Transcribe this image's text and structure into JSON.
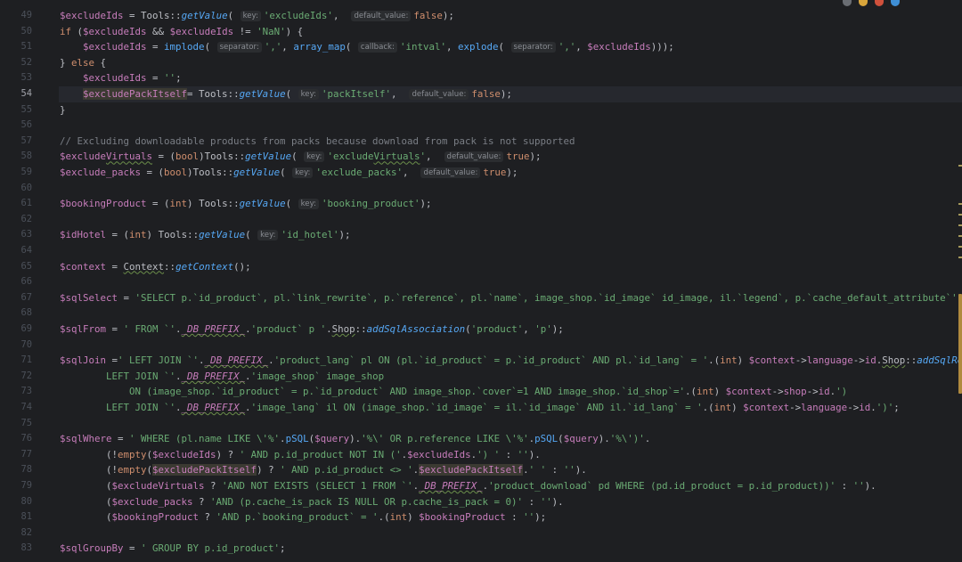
{
  "gutter": {
    "line_numbers": [
      "49",
      "50",
      "51",
      "52",
      "53",
      "54",
      "55",
      "56",
      "57",
      "58",
      "59",
      "60",
      "61",
      "62",
      "63",
      "64",
      "65",
      "66",
      "67",
      "68",
      "69",
      "70",
      "71",
      "72",
      "73",
      "74",
      "75",
      "76",
      "77",
      "78",
      "79",
      "80",
      "81",
      "82",
      "83"
    ],
    "current_line": "54"
  },
  "code_lines": [
    [
      {
        "c": "var",
        "t": "$excludeIds"
      },
      {
        "c": "p",
        "t": " = "
      },
      {
        "c": "cls",
        "t": "Tools"
      },
      {
        "c": "p",
        "t": "::"
      },
      {
        "c": "sfn",
        "t": "getValue"
      },
      {
        "c": "p",
        "t": "( "
      },
      {
        "c": "hint",
        "t": "key:"
      },
      {
        "c": "str",
        "t": "'excludeIds'"
      },
      {
        "c": "p",
        "t": ",  "
      },
      {
        "c": "hint",
        "t": "default_value:"
      },
      {
        "c": "kw",
        "t": "false"
      },
      {
        "c": "p",
        "t": ");"
      }
    ],
    [
      {
        "c": "kw",
        "t": "if"
      },
      {
        "c": "p",
        "t": " ("
      },
      {
        "c": "var",
        "t": "$excludeIds"
      },
      {
        "c": "p",
        "t": " && "
      },
      {
        "c": "var",
        "t": "$excludeIds"
      },
      {
        "c": "p",
        "t": " != "
      },
      {
        "c": "str",
        "t": "'NaN'"
      },
      {
        "c": "p",
        "t": ") {"
      }
    ],
    [
      {
        "c": "p",
        "t": "    "
      },
      {
        "c": "var",
        "t": "$excludeIds"
      },
      {
        "c": "p",
        "t": " = "
      },
      {
        "c": "fn",
        "t": "implode"
      },
      {
        "c": "p",
        "t": "( "
      },
      {
        "c": "hint",
        "t": "separator:"
      },
      {
        "c": "str",
        "t": "','"
      },
      {
        "c": "p",
        "t": ", "
      },
      {
        "c": "fn",
        "t": "array_map"
      },
      {
        "c": "p",
        "t": "( "
      },
      {
        "c": "hint",
        "t": "callback:"
      },
      {
        "c": "str",
        "t": "'intval'"
      },
      {
        "c": "p",
        "t": ", "
      },
      {
        "c": "fn",
        "t": "explode"
      },
      {
        "c": "p",
        "t": "( "
      },
      {
        "c": "hint",
        "t": "separator:"
      },
      {
        "c": "str",
        "t": "','"
      },
      {
        "c": "p",
        "t": ", "
      },
      {
        "c": "var",
        "t": "$excludeIds"
      },
      {
        "c": "p",
        "t": ")));"
      }
    ],
    [
      {
        "c": "p",
        "t": "} "
      },
      {
        "c": "kw",
        "t": "else"
      },
      {
        "c": "p",
        "t": " {"
      }
    ],
    [
      {
        "c": "p",
        "t": "    "
      },
      {
        "c": "var",
        "t": "$excludeIds"
      },
      {
        "c": "p",
        "t": " = "
      },
      {
        "c": "str",
        "t": "''"
      },
      {
        "c": "p",
        "t": ";"
      }
    ],
    [
      {
        "c": "p",
        "t": "    "
      },
      {
        "c": "var hlref",
        "t": "$excludePackItself"
      },
      {
        "c": "p",
        "t": "= "
      },
      {
        "c": "cls",
        "t": "Tools"
      },
      {
        "c": "p",
        "t": "::"
      },
      {
        "c": "sfn",
        "t": "getValue"
      },
      {
        "c": "p",
        "t": "( "
      },
      {
        "c": "hint",
        "t": "key:"
      },
      {
        "c": "str",
        "t": "'packItself'"
      },
      {
        "c": "p",
        "t": ",  "
      },
      {
        "c": "hint",
        "t": "default_value:"
      },
      {
        "c": "kw",
        "t": "false"
      },
      {
        "c": "p",
        "t": ");"
      }
    ],
    [
      {
        "c": "p",
        "t": "}"
      }
    ],
    [],
    [
      {
        "c": "cmt",
        "t": "// Excluding downloadable products from packs because download from pack is not supported"
      }
    ],
    [
      {
        "c": "var",
        "t": "$exclude"
      },
      {
        "c": "var squig",
        "t": "Virtuals"
      },
      {
        "c": "p",
        "t": " = ("
      },
      {
        "c": "kw",
        "t": "bool"
      },
      {
        "c": "p",
        "t": ")"
      },
      {
        "c": "cls",
        "t": "Tools"
      },
      {
        "c": "p",
        "t": "::"
      },
      {
        "c": "sfn",
        "t": "getValue"
      },
      {
        "c": "p",
        "t": "( "
      },
      {
        "c": "hint",
        "t": "key:"
      },
      {
        "c": "str",
        "t": "'exclude"
      },
      {
        "c": "str squig",
        "t": "Virtuals"
      },
      {
        "c": "str",
        "t": "'"
      },
      {
        "c": "p",
        "t": ",  "
      },
      {
        "c": "hint",
        "t": "default_value:"
      },
      {
        "c": "kw",
        "t": "true"
      },
      {
        "c": "p",
        "t": ");"
      }
    ],
    [
      {
        "c": "var",
        "t": "$exclude_packs"
      },
      {
        "c": "p",
        "t": " = ("
      },
      {
        "c": "kw",
        "t": "bool"
      },
      {
        "c": "p",
        "t": ")"
      },
      {
        "c": "cls",
        "t": "Tools"
      },
      {
        "c": "p",
        "t": "::"
      },
      {
        "c": "sfn",
        "t": "getValue"
      },
      {
        "c": "p",
        "t": "( "
      },
      {
        "c": "hint",
        "t": "key:"
      },
      {
        "c": "str",
        "t": "'exclude_packs'"
      },
      {
        "c": "p",
        "t": ",  "
      },
      {
        "c": "hint",
        "t": "default_value:"
      },
      {
        "c": "kw",
        "t": "true"
      },
      {
        "c": "p",
        "t": ");"
      }
    ],
    [],
    [
      {
        "c": "var",
        "t": "$bookingProduct"
      },
      {
        "c": "p",
        "t": " = ("
      },
      {
        "c": "kw",
        "t": "int"
      },
      {
        "c": "p",
        "t": ") "
      },
      {
        "c": "cls",
        "t": "Tools"
      },
      {
        "c": "p",
        "t": "::"
      },
      {
        "c": "sfn",
        "t": "getValue"
      },
      {
        "c": "p",
        "t": "( "
      },
      {
        "c": "hint",
        "t": "key:"
      },
      {
        "c": "str",
        "t": "'booking_product'"
      },
      {
        "c": "p",
        "t": ");"
      }
    ],
    [],
    [
      {
        "c": "var",
        "t": "$idHotel"
      },
      {
        "c": "p",
        "t": " = ("
      },
      {
        "c": "kw",
        "t": "int"
      },
      {
        "c": "p",
        "t": ") "
      },
      {
        "c": "cls",
        "t": "Tools"
      },
      {
        "c": "p",
        "t": "::"
      },
      {
        "c": "sfn",
        "t": "getValue"
      },
      {
        "c": "p",
        "t": "( "
      },
      {
        "c": "hint",
        "t": "key:"
      },
      {
        "c": "str",
        "t": "'id_hotel'"
      },
      {
        "c": "p",
        "t": ");"
      }
    ],
    [],
    [
      {
        "c": "var",
        "t": "$context"
      },
      {
        "c": "p",
        "t": " = "
      },
      {
        "c": "cls squig",
        "t": "Context"
      },
      {
        "c": "p",
        "t": "::"
      },
      {
        "c": "sfn",
        "t": "getContext"
      },
      {
        "c": "p",
        "t": "();"
      }
    ],
    [],
    [
      {
        "c": "var",
        "t": "$sqlSelect"
      },
      {
        "c": "p",
        "t": " = "
      },
      {
        "c": "str",
        "t": "'SELECT p.`id_product`, pl.`link_rewrite`, p.`reference`, pl.`name`, image_shop.`id_image` id_image, il.`legend`, p.`cache_default_attribute`';"
      }
    ],
    [],
    [
      {
        "c": "var",
        "t": "$sqlFrom"
      },
      {
        "c": "p",
        "t": " = "
      },
      {
        "c": "str",
        "t": "' FROM `'"
      },
      {
        "c": "p",
        "t": "."
      },
      {
        "c": "const squig",
        "t": "_DB_PREFIX_"
      },
      {
        "c": "p",
        "t": "."
      },
      {
        "c": "str",
        "t": "'product` p '"
      },
      {
        "c": "p",
        "t": "."
      },
      {
        "c": "cls squig",
        "t": "Shop"
      },
      {
        "c": "p",
        "t": "::"
      },
      {
        "c": "sfn",
        "t": "addSqlAssociation"
      },
      {
        "c": "p",
        "t": "("
      },
      {
        "c": "str",
        "t": "'product'"
      },
      {
        "c": "p",
        "t": ", "
      },
      {
        "c": "str",
        "t": "'p'"
      },
      {
        "c": "p",
        "t": ");"
      }
    ],
    [],
    [
      {
        "c": "var",
        "t": "$sqlJoin"
      },
      {
        "c": "p",
        "t": " ="
      },
      {
        "c": "str",
        "t": "' LEFT JOIN `'"
      },
      {
        "c": "p",
        "t": "."
      },
      {
        "c": "const squig",
        "t": "_DB_PREFIX_"
      },
      {
        "c": "p",
        "t": "."
      },
      {
        "c": "str",
        "t": "'product_lang` pl ON (pl.`id_product` = p.`id_product` AND pl.`id_lang` = '"
      },
      {
        "c": "p",
        "t": ".("
      },
      {
        "c": "kw",
        "t": "int"
      },
      {
        "c": "p",
        "t": ") "
      },
      {
        "c": "var",
        "t": "$context"
      },
      {
        "c": "p",
        "t": "->"
      },
      {
        "c": "var",
        "t": "language"
      },
      {
        "c": "p",
        "t": "->"
      },
      {
        "c": "var",
        "t": "id"
      },
      {
        "c": "p",
        "t": "."
      },
      {
        "c": "cls squig",
        "t": "Shop"
      },
      {
        "c": "p",
        "t": "::"
      },
      {
        "c": "sfn",
        "t": "addSqlRest"
      }
    ],
    [
      {
        "c": "str",
        "t": "        LEFT JOIN `'"
      },
      {
        "c": "p",
        "t": "."
      },
      {
        "c": "const squig",
        "t": "_DB_PREFIX_"
      },
      {
        "c": "p",
        "t": "."
      },
      {
        "c": "str",
        "t": "'image_shop` image_shop"
      }
    ],
    [
      {
        "c": "str",
        "t": "            ON (image_shop.`id_product` = p.`id_product` AND image_shop.`cover`=1 AND image_shop.`id_shop`='"
      },
      {
        "c": "p",
        "t": ".("
      },
      {
        "c": "kw",
        "t": "int"
      },
      {
        "c": "p",
        "t": ") "
      },
      {
        "c": "var",
        "t": "$context"
      },
      {
        "c": "p",
        "t": "->"
      },
      {
        "c": "var",
        "t": "shop"
      },
      {
        "c": "p",
        "t": "->"
      },
      {
        "c": "var",
        "t": "id"
      },
      {
        "c": "p",
        "t": "."
      },
      {
        "c": "str",
        "t": "')"
      }
    ],
    [
      {
        "c": "str",
        "t": "        LEFT JOIN `'"
      },
      {
        "c": "p",
        "t": "."
      },
      {
        "c": "const squig",
        "t": "_DB_PREFIX_"
      },
      {
        "c": "p",
        "t": "."
      },
      {
        "c": "str",
        "t": "'image_lang` il ON (image_shop.`id_image` = il.`id_image` AND il.`id_lang` = '"
      },
      {
        "c": "p",
        "t": ".("
      },
      {
        "c": "kw",
        "t": "int"
      },
      {
        "c": "p",
        "t": ") "
      },
      {
        "c": "var",
        "t": "$context"
      },
      {
        "c": "p",
        "t": "->"
      },
      {
        "c": "var",
        "t": "language"
      },
      {
        "c": "p",
        "t": "->"
      },
      {
        "c": "var",
        "t": "id"
      },
      {
        "c": "p",
        "t": "."
      },
      {
        "c": "str",
        "t": "')'"
      },
      {
        "c": "p",
        "t": ";"
      }
    ],
    [],
    [
      {
        "c": "var",
        "t": "$sqlWhere"
      },
      {
        "c": "p",
        "t": " = "
      },
      {
        "c": "str",
        "t": "' WHERE (pl.name LIKE \\'%'"
      },
      {
        "c": "p",
        "t": "."
      },
      {
        "c": "fn",
        "t": "pSQL"
      },
      {
        "c": "p",
        "t": "("
      },
      {
        "c": "var",
        "t": "$query"
      },
      {
        "c": "p",
        "t": ")."
      },
      {
        "c": "str",
        "t": "'%\\' OR p.reference LIKE \\'%'"
      },
      {
        "c": "p",
        "t": "."
      },
      {
        "c": "fn",
        "t": "pSQL"
      },
      {
        "c": "p",
        "t": "("
      },
      {
        "c": "var",
        "t": "$query"
      },
      {
        "c": "p",
        "t": ")."
      },
      {
        "c": "str",
        "t": "'%\\')'"
      },
      {
        "c": "p",
        "t": "."
      }
    ],
    [
      {
        "c": "p",
        "t": "        (!"
      },
      {
        "c": "kw",
        "t": "empty"
      },
      {
        "c": "p",
        "t": "("
      },
      {
        "c": "var",
        "t": "$excludeIds"
      },
      {
        "c": "p",
        "t": ") ? "
      },
      {
        "c": "str",
        "t": "' AND p.id_product NOT IN ('"
      },
      {
        "c": "p",
        "t": "."
      },
      {
        "c": "var",
        "t": "$excludeIds"
      },
      {
        "c": "p",
        "t": "."
      },
      {
        "c": "str",
        "t": "') '"
      },
      {
        "c": "p",
        "t": " : "
      },
      {
        "c": "str",
        "t": "''"
      },
      {
        "c": "p",
        "t": ")."
      }
    ],
    [
      {
        "c": "p",
        "t": "        (!"
      },
      {
        "c": "kw",
        "t": "empty"
      },
      {
        "c": "p",
        "t": "("
      },
      {
        "c": "var hlref",
        "t": "$excludePackItself"
      },
      {
        "c": "p",
        "t": ") ? "
      },
      {
        "c": "str",
        "t": "' AND p.id_product <> '"
      },
      {
        "c": "p",
        "t": "."
      },
      {
        "c": "var hlref",
        "t": "$excludePackItself"
      },
      {
        "c": "p",
        "t": "."
      },
      {
        "c": "str",
        "t": "' '"
      },
      {
        "c": "p",
        "t": " : "
      },
      {
        "c": "str",
        "t": "''"
      },
      {
        "c": "p",
        "t": ")."
      }
    ],
    [
      {
        "c": "p",
        "t": "        ("
      },
      {
        "c": "var",
        "t": "$excludeVirtuals"
      },
      {
        "c": "p",
        "t": " ? "
      },
      {
        "c": "str",
        "t": "'AND NOT EXISTS (SELECT 1 FROM `'"
      },
      {
        "c": "p",
        "t": "."
      },
      {
        "c": "const squig",
        "t": "_DB_PREFIX_"
      },
      {
        "c": "p",
        "t": "."
      },
      {
        "c": "str",
        "t": "'product_download` pd WHERE (pd.id_product = p.id_product))'"
      },
      {
        "c": "p",
        "t": " : "
      },
      {
        "c": "str",
        "t": "''"
      },
      {
        "c": "p",
        "t": ")."
      }
    ],
    [
      {
        "c": "p",
        "t": "        ("
      },
      {
        "c": "var",
        "t": "$exclude_packs"
      },
      {
        "c": "p",
        "t": " ? "
      },
      {
        "c": "str",
        "t": "'AND (p.cache_is_pack IS NULL OR p.cache_is_pack = 0)'"
      },
      {
        "c": "p",
        "t": " : "
      },
      {
        "c": "str",
        "t": "''"
      },
      {
        "c": "p",
        "t": ")."
      }
    ],
    [
      {
        "c": "p",
        "t": "        ("
      },
      {
        "c": "var",
        "t": "$bookingProduct"
      },
      {
        "c": "p",
        "t": " ? "
      },
      {
        "c": "str",
        "t": "'AND p.`booking_product` = '"
      },
      {
        "c": "p",
        "t": ".("
      },
      {
        "c": "kw",
        "t": "int"
      },
      {
        "c": "p",
        "t": ") "
      },
      {
        "c": "var",
        "t": "$bookingProduct"
      },
      {
        "c": "p",
        "t": " : "
      },
      {
        "c": "str",
        "t": "''"
      },
      {
        "c": "p",
        "t": ");"
      }
    ],
    [],
    [
      {
        "c": "var",
        "t": "$sqlGroupBy"
      },
      {
        "c": "p",
        "t": " = "
      },
      {
        "c": "str",
        "t": "' GROUP BY p.id_product'"
      },
      {
        "c": "p",
        "t": ";"
      }
    ]
  ],
  "colors": {
    "background": "#1e1f22",
    "variable": "#c77dbb",
    "keyword": "#cf8e6d",
    "string": "#6aab73",
    "function": "#56a8f5",
    "comment": "#7a7e85",
    "current_line": "#26282e"
  },
  "top_icons": [
    "plugin-icon",
    "chrome-icon",
    "firefox-icon",
    "edge-icon"
  ]
}
